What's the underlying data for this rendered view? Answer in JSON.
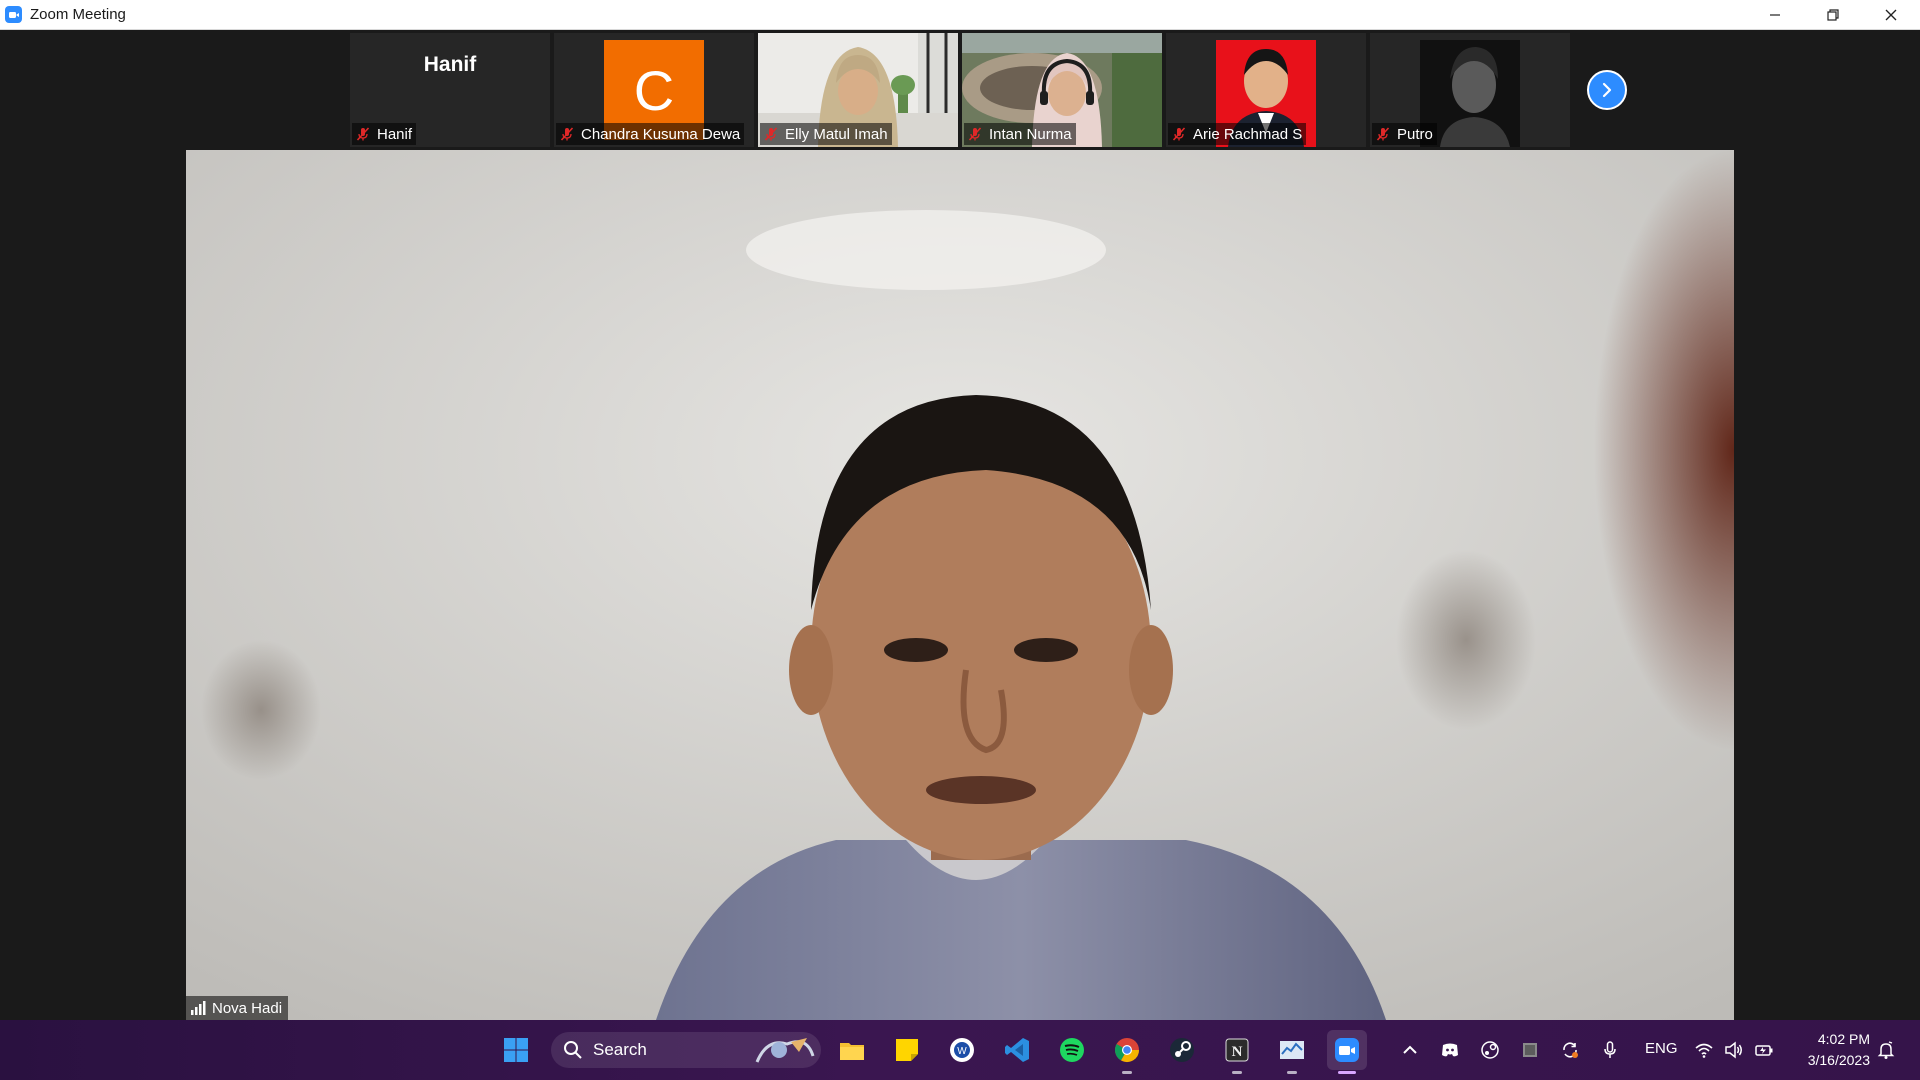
{
  "window": {
    "title": "Zoom Meeting"
  },
  "participants": [
    {
      "display": "Hanif",
      "label": "Hanif",
      "type": "name"
    },
    {
      "display": "C",
      "label": "Chandra Kusuma Dewa",
      "type": "avatar",
      "color": "#f26d00"
    },
    {
      "label": "Elly Matul Imah",
      "type": "photo"
    },
    {
      "label": "Intan Nurma",
      "type": "photo"
    },
    {
      "label": "Arie Rachmad S",
      "type": "photo"
    },
    {
      "label": "Putro",
      "type": "photo"
    }
  ],
  "active_speaker": {
    "name": "Nova Hadi"
  },
  "taskbar": {
    "search_label": "Search",
    "language": "ENG",
    "time": "4:02 PM",
    "date": "3/16/2023"
  },
  "colors": {
    "zoom_blue": "#2d8cff",
    "mute_red": "#e02828"
  }
}
